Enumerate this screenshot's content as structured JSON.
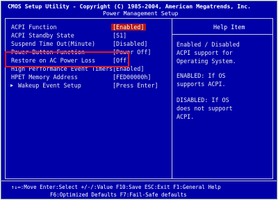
{
  "header": {
    "title": "CMOS Setup Utility - Copyright (C) 1985-2004, American Megatrends, Inc.",
    "subtitle": "Power Management Setup"
  },
  "settings": [
    {
      "label": "ACPI Function",
      "value": "[Enabled]"
    },
    {
      "label": "ACPI Standby State",
      "value": "[S1]"
    },
    {
      "label": "Suspend Time Out(Minute)",
      "value": "[Disabled]"
    },
    {
      "label": "Power Button Function",
      "value": "[Power Off]"
    },
    {
      "label": "Restore on AC Power Loss",
      "value": "[Off]"
    },
    {
      "label": "High Performance Event Timers",
      "value": "[Enabled]"
    },
    {
      "label": "HPET Memory Address",
      "value": "[FED00000h]"
    },
    {
      "label": "Wakeup Event Setup",
      "value": "[Press Enter]"
    }
  ],
  "submenu_marker": "▶",
  "help": {
    "title": "Help Item",
    "lines": [
      "Enabled / Disabled",
      "ACPI support for",
      "Operating System.",
      "",
      "ENABLED: If OS",
      "supports ACPI.",
      "",
      "DISABLED: If OS",
      "does not support",
      "ACPI."
    ]
  },
  "footer": {
    "line1": "↑↓↔:Move  Enter:Select  +/-/:Value  F10:Save  ESC:Exit  F1:General Help",
    "line2": "F6:Optimized Defaults       F7:Fail-Safe defaults"
  },
  "colors": {
    "background": "#0000a8",
    "selected": "#b01818",
    "annotation": "#e31b1b"
  }
}
